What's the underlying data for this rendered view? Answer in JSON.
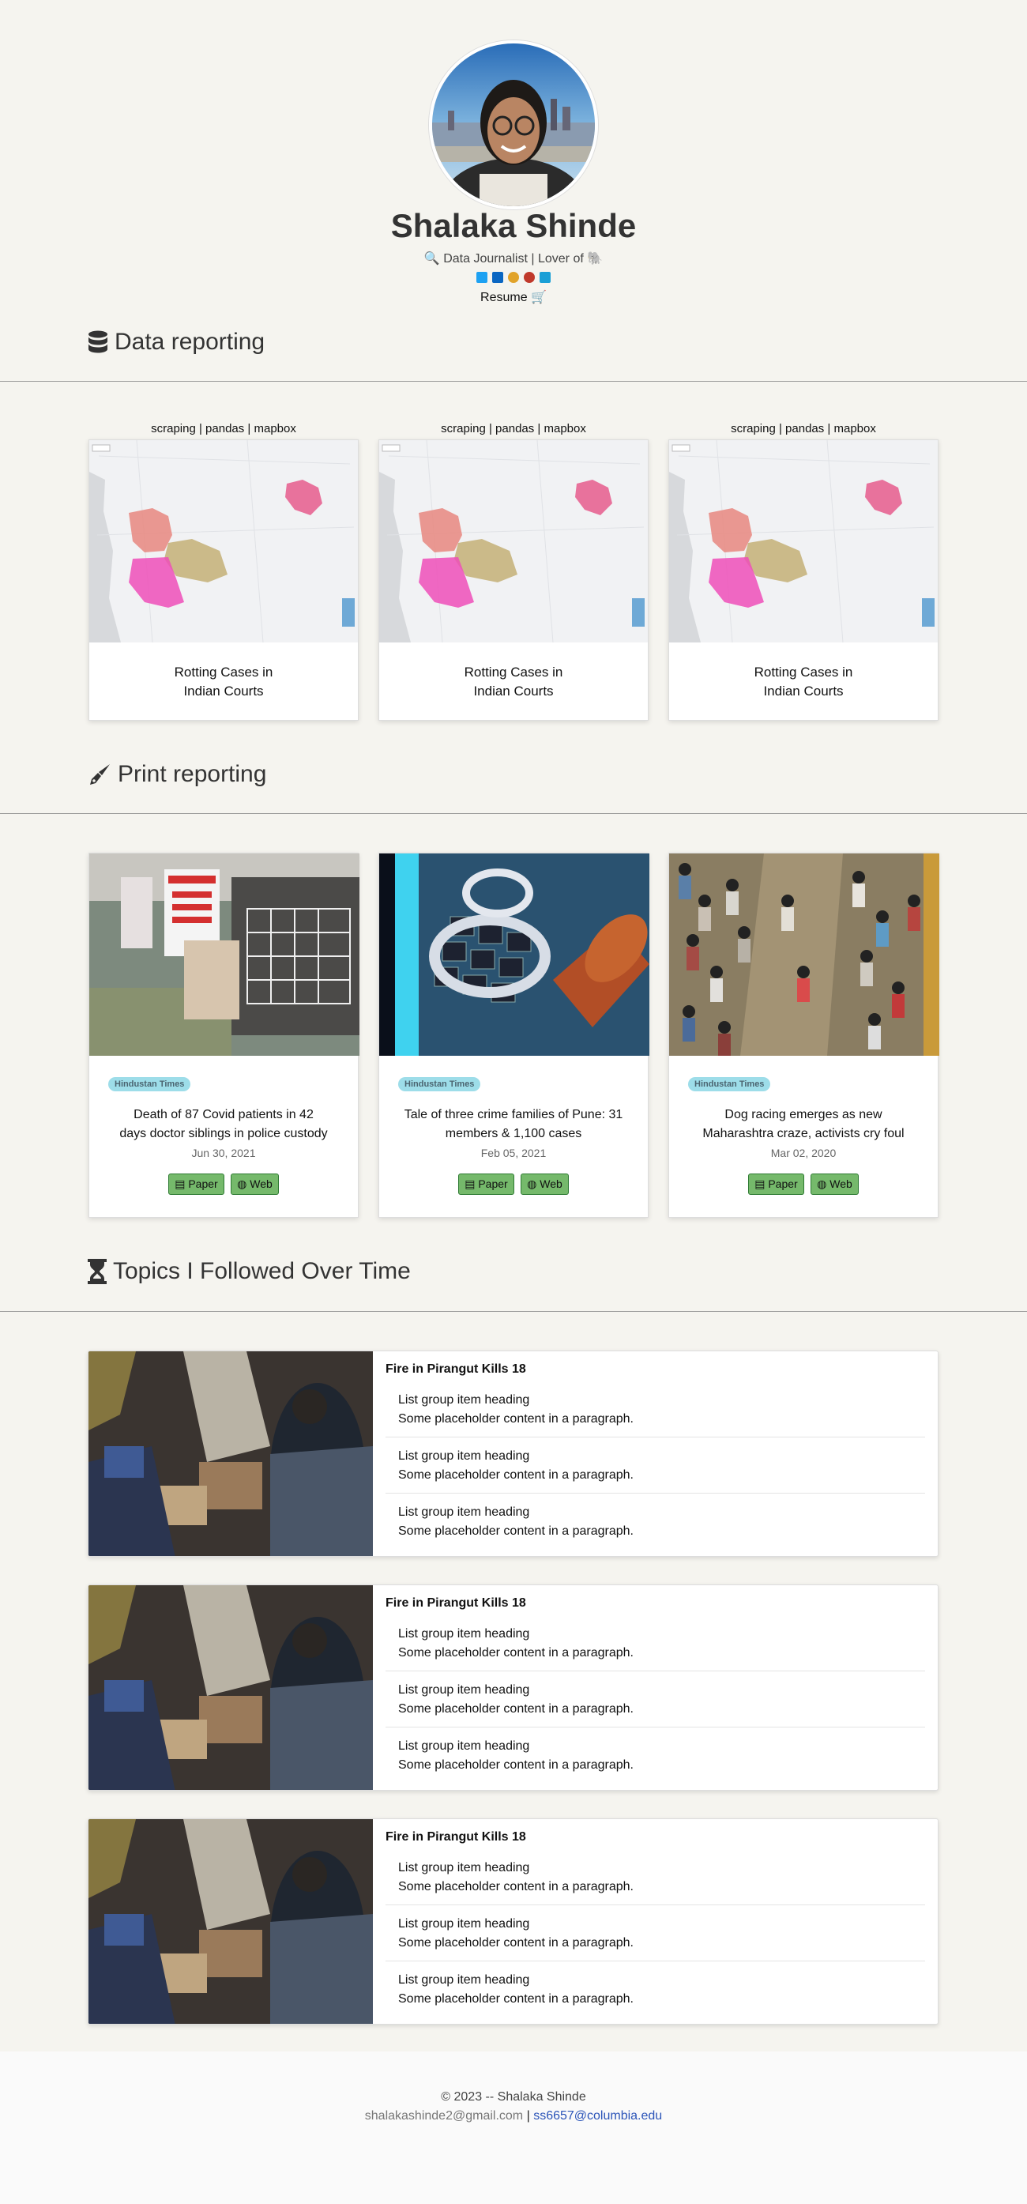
{
  "profile": {
    "name": "Shalaka Shinde",
    "tagline_prefix": "🔍",
    "tagline": "Data Journalist | Lover of",
    "tagline_suffix": "🐘",
    "resume_label": "Resume",
    "resume_icon": "🛒",
    "social_icons": [
      "twitter-icon",
      "linkedin-icon",
      "instagram-icon",
      "github-icon",
      "email-icon"
    ],
    "social_colors": [
      "#1da1f2",
      "#0a66c2",
      "#e1306c",
      "#333333",
      "#1a9fd6"
    ]
  },
  "sections": {
    "data": {
      "title": "Data reporting",
      "icon": "database-icon"
    },
    "print": {
      "title": "Print reporting",
      "icon": "pen-nib-icon"
    },
    "topics": {
      "title": "Topics I Followed Over Time",
      "icon": "hourglass-icon"
    }
  },
  "data_cards": [
    {
      "stack": "scraping | pandas | mapbox",
      "title_l1": "Rotting Cases in",
      "title_l2": "Indian Courts"
    },
    {
      "stack": "scraping | pandas | mapbox",
      "title_l1": "Rotting Cases in",
      "title_l2": "Indian Courts"
    },
    {
      "stack": "scraping | pandas | mapbox",
      "title_l1": "Rotting Cases in",
      "title_l2": "Indian Courts"
    }
  ],
  "print_cards": [
    {
      "source": "Hindustan Times",
      "title_l1": "Death of 87 Covid patients in 42",
      "title_l2": "days doctor siblings in police custody",
      "date": "Jun 30, 2021",
      "btn_paper": "Paper",
      "btn_web": "Web"
    },
    {
      "source": "Hindustan Times",
      "title_l1": "Tale of three crime families of Pune: 31",
      "title_l2": "members & 1,100 cases",
      "date": "Feb 05, 2021",
      "btn_paper": "Paper",
      "btn_web": "Web"
    },
    {
      "source": "Hindustan Times",
      "title_l1": "Dog racing emerges as new",
      "title_l2": "Maharashtra craze, activists cry foul",
      "date": "Mar 02, 2020",
      "btn_paper": "Paper",
      "btn_web": "Web"
    }
  ],
  "topics": [
    {
      "title": "Fire in Pirangut Kills 18",
      "items": [
        {
          "heading": "List group item heading",
          "text": "Some placeholder content in a paragraph."
        },
        {
          "heading": "List group item heading",
          "text": "Some placeholder content in a paragraph."
        },
        {
          "heading": "List group item heading",
          "text": "Some placeholder content in a paragraph."
        }
      ]
    },
    {
      "title": "Fire in Pirangut Kills 18",
      "items": [
        {
          "heading": "List group item heading",
          "text": "Some placeholder content in a paragraph."
        },
        {
          "heading": "List group item heading",
          "text": "Some placeholder content in a paragraph."
        },
        {
          "heading": "List group item heading",
          "text": "Some placeholder content in a paragraph."
        }
      ]
    },
    {
      "title": "Fire in Pirangut Kills 18",
      "items": [
        {
          "heading": "List group item heading",
          "text": "Some placeholder content in a paragraph."
        },
        {
          "heading": "List group item heading",
          "text": "Some placeholder content in a paragraph."
        },
        {
          "heading": "List group item heading",
          "text": "Some placeholder content in a paragraph."
        }
      ]
    }
  ],
  "footer": {
    "copyright": "© 2023 -- Shalaka Shinde",
    "email": "shalakashinde2@gmail.com",
    "separator": "|",
    "edu_email": "ss6657@columbia.edu"
  }
}
